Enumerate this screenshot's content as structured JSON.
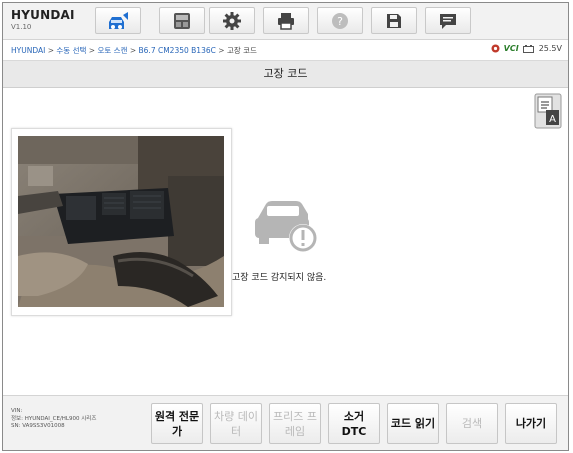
{
  "header": {
    "brand": "HYUNDAI",
    "version": "V1.10",
    "toolbar_icons": [
      "car-home-icon",
      "vehicle-switch-icon",
      "gear-icon",
      "printer-icon",
      "help-icon",
      "save-icon",
      "message-icon"
    ]
  },
  "breadcrumb": {
    "items": [
      "HYUNDAI",
      "수동 선택",
      "오토 스캔",
      "B6.7 CM2350 B136C",
      "고장 코드"
    ],
    "separator": ">"
  },
  "status": {
    "vci_label": "VCI",
    "voltage": "25.5V"
  },
  "page": {
    "title": "고장 코드"
  },
  "content": {
    "no_code_message": "고장 코드 감지되지 않음."
  },
  "footer": {
    "vin_label": "VIN:",
    "info_line": "정보: HYUNDAI_CE/HL900 시리즈",
    "sn_line": "SN: VA9SS3V01008"
  },
  "buttons": [
    {
      "label": "원격 전문가",
      "enabled": true
    },
    {
      "label": "차량 데이터",
      "enabled": false
    },
    {
      "label": "프리즈 프레임",
      "enabled": false
    },
    {
      "label": "소거 DTC",
      "enabled": true
    },
    {
      "label": "코드 읽기",
      "enabled": true
    },
    {
      "label": "검색",
      "enabled": false
    },
    {
      "label": "나가기",
      "enabled": true
    }
  ],
  "colors": {
    "link": "#2866b8",
    "accent_blue": "#1f6fd1",
    "disabled_text": "#b9b9b9"
  }
}
